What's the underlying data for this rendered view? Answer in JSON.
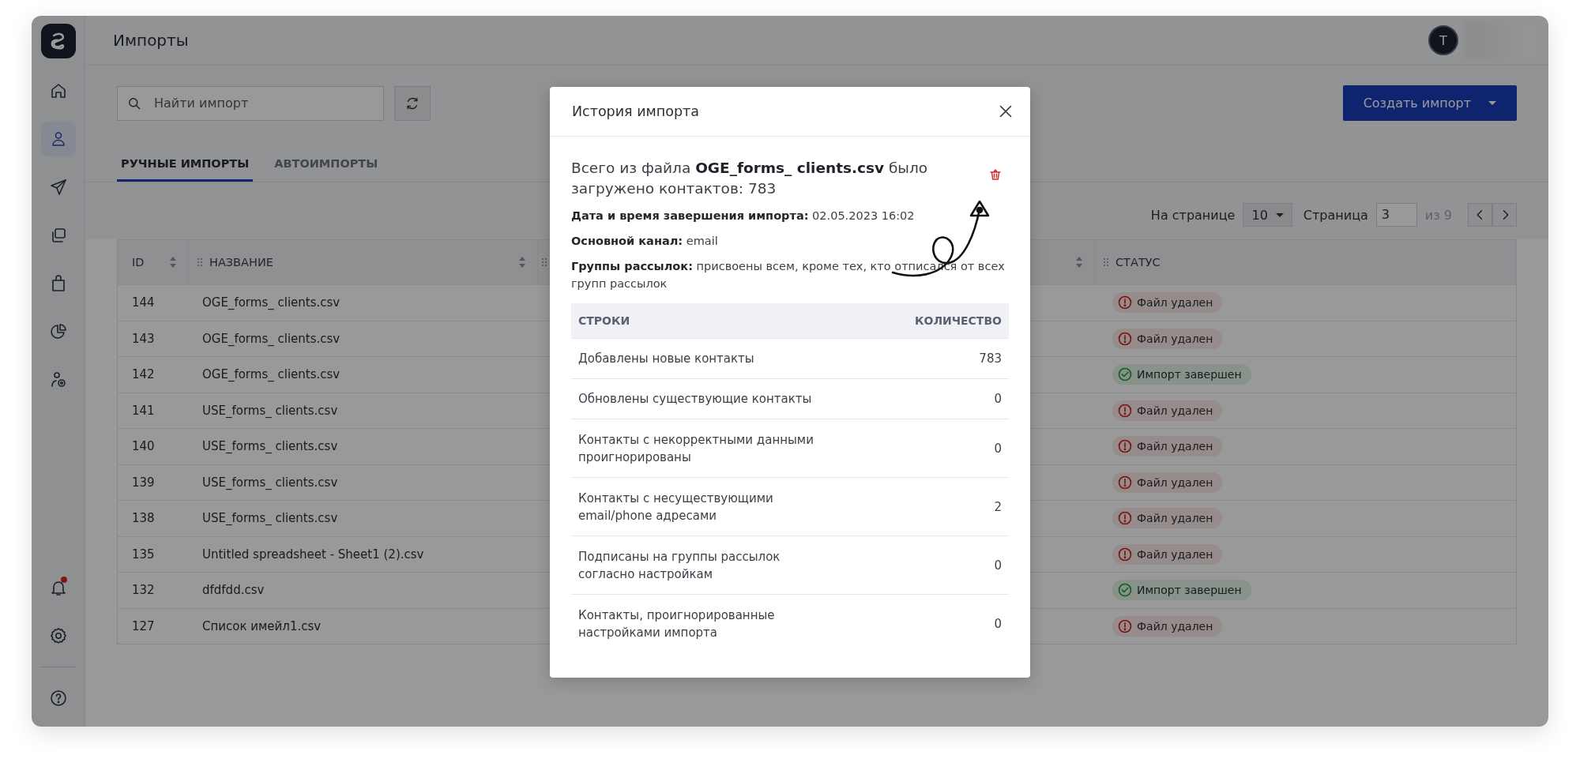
{
  "sidebar": {
    "items": [
      {
        "kind": "home",
        "selected": false
      },
      {
        "kind": "contacts",
        "selected": true
      },
      {
        "kind": "send",
        "selected": false
      },
      {
        "kind": "copies",
        "selected": false
      },
      {
        "kind": "bag",
        "selected": false
      },
      {
        "kind": "pie",
        "selected": false
      },
      {
        "kind": "user-settings",
        "selected": false
      }
    ],
    "bottom_items": [
      {
        "kind": "bell",
        "unread": true
      },
      {
        "kind": "settings",
        "unread": false
      },
      {
        "kind": "help",
        "unread": false
      }
    ]
  },
  "header": {
    "title": "Импорты",
    "avatar": "T"
  },
  "toolbar": {
    "search": {
      "placeholder": "Найти импорт"
    },
    "create_button": "Создать импорт"
  },
  "tabs": [
    {
      "label": "РУЧНЫЕ ИМПОРТЫ",
      "selected": true
    },
    {
      "label": "АВТОИМПОРТЫ",
      "selected": false
    }
  ],
  "pagination": {
    "per_page_label": "На странице",
    "per_page": "10",
    "page_label": "Страница",
    "page": "3",
    "total": "из 9"
  },
  "table": {
    "columns": [
      {
        "label": "ID",
        "sortable": true,
        "draggable": false
      },
      {
        "label": "НАЗВАНИЕ",
        "sortable": true,
        "draggable": true
      },
      {
        "sortable": true,
        "draggable": true
      },
      {
        "label": "СТАТУС",
        "sortable": false,
        "draggable": true
      }
    ],
    "rows": [
      {
        "id": "144",
        "name": "OGE_forms_ clients.csv",
        "status": {
          "kind": "error",
          "label": "Файл удален"
        }
      },
      {
        "id": "143",
        "name": "OGE_forms_ clients.csv",
        "status": {
          "kind": "error",
          "label": "Файл удален"
        }
      },
      {
        "id": "142",
        "name": "OGE_forms_ clients.csv",
        "status": {
          "kind": "success",
          "label": "Импорт завершен"
        }
      },
      {
        "id": "141",
        "name": "USE_forms_ clients.csv",
        "status": {
          "kind": "error",
          "label": "Файл удален"
        }
      },
      {
        "id": "140",
        "name": "USE_forms_ clients.csv",
        "status": {
          "kind": "error",
          "label": "Файл удален"
        }
      },
      {
        "id": "139",
        "name": "USE_forms_ clients.csv",
        "status": {
          "kind": "error",
          "label": "Файл удален"
        }
      },
      {
        "id": "138",
        "name": "USE_forms_ clients.csv",
        "status": {
          "kind": "error",
          "label": "Файл удален"
        }
      },
      {
        "id": "135",
        "name": "Untitled spreadsheet - Sheet1 (2).csv",
        "status": {
          "kind": "error",
          "label": "Файл удален"
        }
      },
      {
        "id": "132",
        "name": "dfdfdd.csv",
        "status": {
          "kind": "success",
          "label": "Импорт завершен"
        }
      },
      {
        "id": "127",
        "name": "Список имейл1.csv",
        "status": {
          "kind": "error",
          "label": "Файл удален"
        }
      }
    ]
  },
  "modal": {
    "title": "История импорта",
    "summary": "Всего из файла **OGE_forms_ clients.csv** было загружено контактов: 783",
    "details": [
      "**Дата и время завершения импорта:** 02.05.2023 16:02",
      "**Основной канал:** email",
      "**Группы рассылок:** присвоены всем, кроме тех, кто отписался от всех групп рассылок"
    ],
    "table": {
      "columns": [
        "СТРОКИ",
        "КОЛИЧЕСТВО"
      ],
      "rows": [
        {
          "label": "Добавлены новые контакты",
          "count": "783"
        },
        {
          "label": "Обновлены существующие контакты",
          "count": "0"
        },
        {
          "label": "Контакты с некорректными данными проигнорированы",
          "count": "0"
        },
        {
          "label": "Контакты с несуществующими email/phone адресами",
          "count": "2"
        },
        {
          "label": "Подписаны на группы рассылок согласно настройкам",
          "count": "0"
        },
        {
          "label": "Контакты, проигнорированные настройками импорта",
          "count": "0"
        }
      ]
    }
  }
}
